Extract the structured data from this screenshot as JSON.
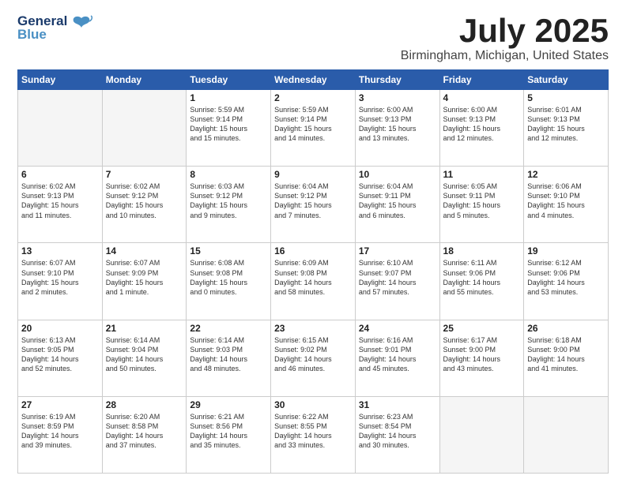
{
  "logo": {
    "line1": "General",
    "line2": "Blue"
  },
  "title": "July 2025",
  "subtitle": "Birmingham, Michigan, United States",
  "days_of_week": [
    "Sunday",
    "Monday",
    "Tuesday",
    "Wednesday",
    "Thursday",
    "Friday",
    "Saturday"
  ],
  "weeks": [
    [
      {
        "num": "",
        "info": ""
      },
      {
        "num": "",
        "info": ""
      },
      {
        "num": "1",
        "info": "Sunrise: 5:59 AM\nSunset: 9:14 PM\nDaylight: 15 hours\nand 15 minutes."
      },
      {
        "num": "2",
        "info": "Sunrise: 5:59 AM\nSunset: 9:14 PM\nDaylight: 15 hours\nand 14 minutes."
      },
      {
        "num": "3",
        "info": "Sunrise: 6:00 AM\nSunset: 9:13 PM\nDaylight: 15 hours\nand 13 minutes."
      },
      {
        "num": "4",
        "info": "Sunrise: 6:00 AM\nSunset: 9:13 PM\nDaylight: 15 hours\nand 12 minutes."
      },
      {
        "num": "5",
        "info": "Sunrise: 6:01 AM\nSunset: 9:13 PM\nDaylight: 15 hours\nand 12 minutes."
      }
    ],
    [
      {
        "num": "6",
        "info": "Sunrise: 6:02 AM\nSunset: 9:13 PM\nDaylight: 15 hours\nand 11 minutes."
      },
      {
        "num": "7",
        "info": "Sunrise: 6:02 AM\nSunset: 9:12 PM\nDaylight: 15 hours\nand 10 minutes."
      },
      {
        "num": "8",
        "info": "Sunrise: 6:03 AM\nSunset: 9:12 PM\nDaylight: 15 hours\nand 9 minutes."
      },
      {
        "num": "9",
        "info": "Sunrise: 6:04 AM\nSunset: 9:12 PM\nDaylight: 15 hours\nand 7 minutes."
      },
      {
        "num": "10",
        "info": "Sunrise: 6:04 AM\nSunset: 9:11 PM\nDaylight: 15 hours\nand 6 minutes."
      },
      {
        "num": "11",
        "info": "Sunrise: 6:05 AM\nSunset: 9:11 PM\nDaylight: 15 hours\nand 5 minutes."
      },
      {
        "num": "12",
        "info": "Sunrise: 6:06 AM\nSunset: 9:10 PM\nDaylight: 15 hours\nand 4 minutes."
      }
    ],
    [
      {
        "num": "13",
        "info": "Sunrise: 6:07 AM\nSunset: 9:10 PM\nDaylight: 15 hours\nand 2 minutes."
      },
      {
        "num": "14",
        "info": "Sunrise: 6:07 AM\nSunset: 9:09 PM\nDaylight: 15 hours\nand 1 minute."
      },
      {
        "num": "15",
        "info": "Sunrise: 6:08 AM\nSunset: 9:08 PM\nDaylight: 15 hours\nand 0 minutes."
      },
      {
        "num": "16",
        "info": "Sunrise: 6:09 AM\nSunset: 9:08 PM\nDaylight: 14 hours\nand 58 minutes."
      },
      {
        "num": "17",
        "info": "Sunrise: 6:10 AM\nSunset: 9:07 PM\nDaylight: 14 hours\nand 57 minutes."
      },
      {
        "num": "18",
        "info": "Sunrise: 6:11 AM\nSunset: 9:06 PM\nDaylight: 14 hours\nand 55 minutes."
      },
      {
        "num": "19",
        "info": "Sunrise: 6:12 AM\nSunset: 9:06 PM\nDaylight: 14 hours\nand 53 minutes."
      }
    ],
    [
      {
        "num": "20",
        "info": "Sunrise: 6:13 AM\nSunset: 9:05 PM\nDaylight: 14 hours\nand 52 minutes."
      },
      {
        "num": "21",
        "info": "Sunrise: 6:14 AM\nSunset: 9:04 PM\nDaylight: 14 hours\nand 50 minutes."
      },
      {
        "num": "22",
        "info": "Sunrise: 6:14 AM\nSunset: 9:03 PM\nDaylight: 14 hours\nand 48 minutes."
      },
      {
        "num": "23",
        "info": "Sunrise: 6:15 AM\nSunset: 9:02 PM\nDaylight: 14 hours\nand 46 minutes."
      },
      {
        "num": "24",
        "info": "Sunrise: 6:16 AM\nSunset: 9:01 PM\nDaylight: 14 hours\nand 45 minutes."
      },
      {
        "num": "25",
        "info": "Sunrise: 6:17 AM\nSunset: 9:00 PM\nDaylight: 14 hours\nand 43 minutes."
      },
      {
        "num": "26",
        "info": "Sunrise: 6:18 AM\nSunset: 9:00 PM\nDaylight: 14 hours\nand 41 minutes."
      }
    ],
    [
      {
        "num": "27",
        "info": "Sunrise: 6:19 AM\nSunset: 8:59 PM\nDaylight: 14 hours\nand 39 minutes."
      },
      {
        "num": "28",
        "info": "Sunrise: 6:20 AM\nSunset: 8:58 PM\nDaylight: 14 hours\nand 37 minutes."
      },
      {
        "num": "29",
        "info": "Sunrise: 6:21 AM\nSunset: 8:56 PM\nDaylight: 14 hours\nand 35 minutes."
      },
      {
        "num": "30",
        "info": "Sunrise: 6:22 AM\nSunset: 8:55 PM\nDaylight: 14 hours\nand 33 minutes."
      },
      {
        "num": "31",
        "info": "Sunrise: 6:23 AM\nSunset: 8:54 PM\nDaylight: 14 hours\nand 30 minutes."
      },
      {
        "num": "",
        "info": ""
      },
      {
        "num": "",
        "info": ""
      }
    ]
  ]
}
